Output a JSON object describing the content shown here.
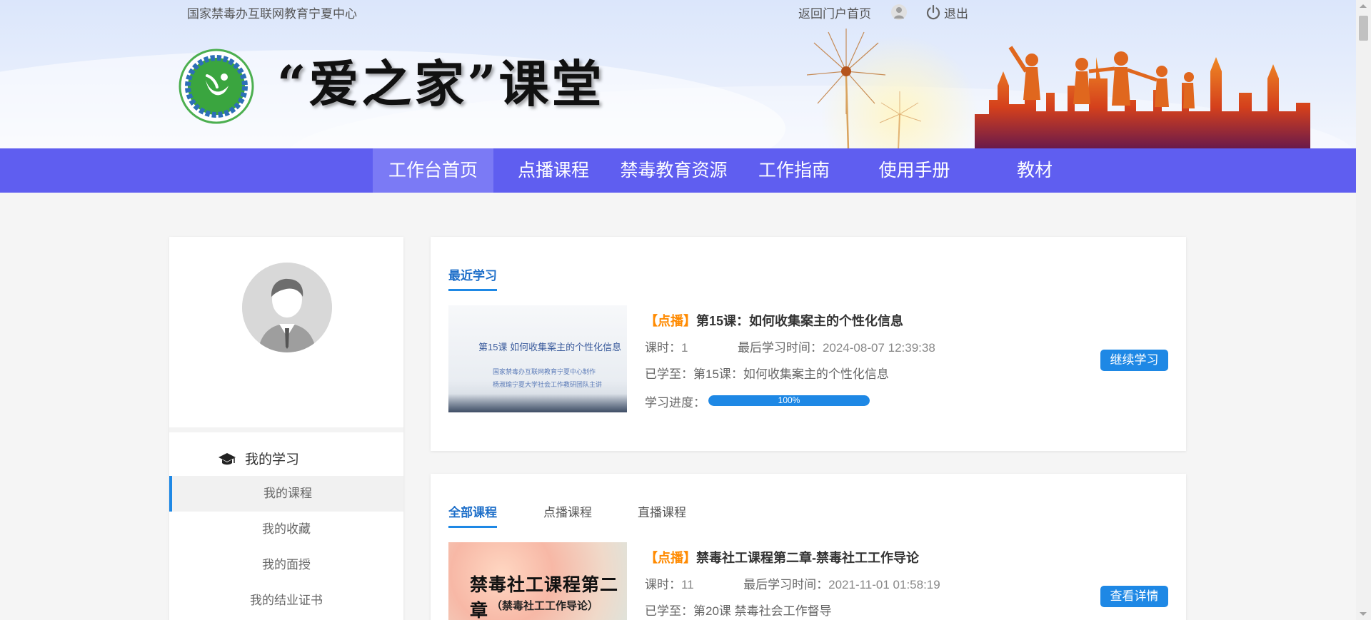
{
  "header": {
    "org_name": "国家禁毒办互联网教育宁夏中心",
    "back_link": "返回门户首页",
    "logout": "退出",
    "slogan": "“爱之家”课堂"
  },
  "nav": {
    "items": [
      {
        "label": "工作台首页",
        "active": true
      },
      {
        "label": "点播课程"
      },
      {
        "label": "禁毒教育资源"
      },
      {
        "label": "工作指南"
      },
      {
        "label": "使用手册"
      },
      {
        "label": "教材"
      }
    ]
  },
  "sidebar": {
    "section_title": "我的学习",
    "items": [
      {
        "label": "我的课程",
        "active": true
      },
      {
        "label": "我的收藏"
      },
      {
        "label": "我的面授"
      },
      {
        "label": "我的结业证书"
      }
    ]
  },
  "recent": {
    "tab": "最近学习",
    "course": {
      "tag": "【点播】",
      "title": "第15课：如何收集案主的个性化信息",
      "hours_label": "课时：",
      "hours": "1",
      "last_label": "最后学习时间：",
      "last_time": "2024-08-07 12:39:38",
      "progress_text_label": "已学至：",
      "progress_text": "第15课：如何收集案主的个性化信息",
      "progress_label": "学习进度：",
      "progress_percent": "100%",
      "progress_value": 1.0,
      "button": "继续学习",
      "thumb_title": "第15课 如何收集案主的个性化信息",
      "thumb_line1": "国家禁毒办互联网教育宁夏中心制作",
      "thumb_line2": "杨淑瑜宁夏大学社会工作教研团队主讲"
    }
  },
  "all_courses": {
    "tabs": [
      {
        "label": "全部课程",
        "active": true
      },
      {
        "label": "点播课程"
      },
      {
        "label": "直播课程"
      }
    ],
    "course": {
      "tag": "【点播】",
      "title": "禁毒社工课程第二章-禁毒社工工作导论",
      "hours_label": "课时：",
      "hours": "11",
      "last_label": "最后学习时间：",
      "last_time": "2021-11-01 01:58:19",
      "progress_text_label": "已学至：",
      "progress_text": "第20课 禁毒社会工作督导",
      "button": "查看详情",
      "thumb_big": "禁毒社工课程第二章",
      "thumb_small": "（禁毒社工工作导论）"
    }
  },
  "colors": {
    "nav": "#5f5ef0",
    "accent": "#1e88e5",
    "tag": "#ff8a00"
  }
}
